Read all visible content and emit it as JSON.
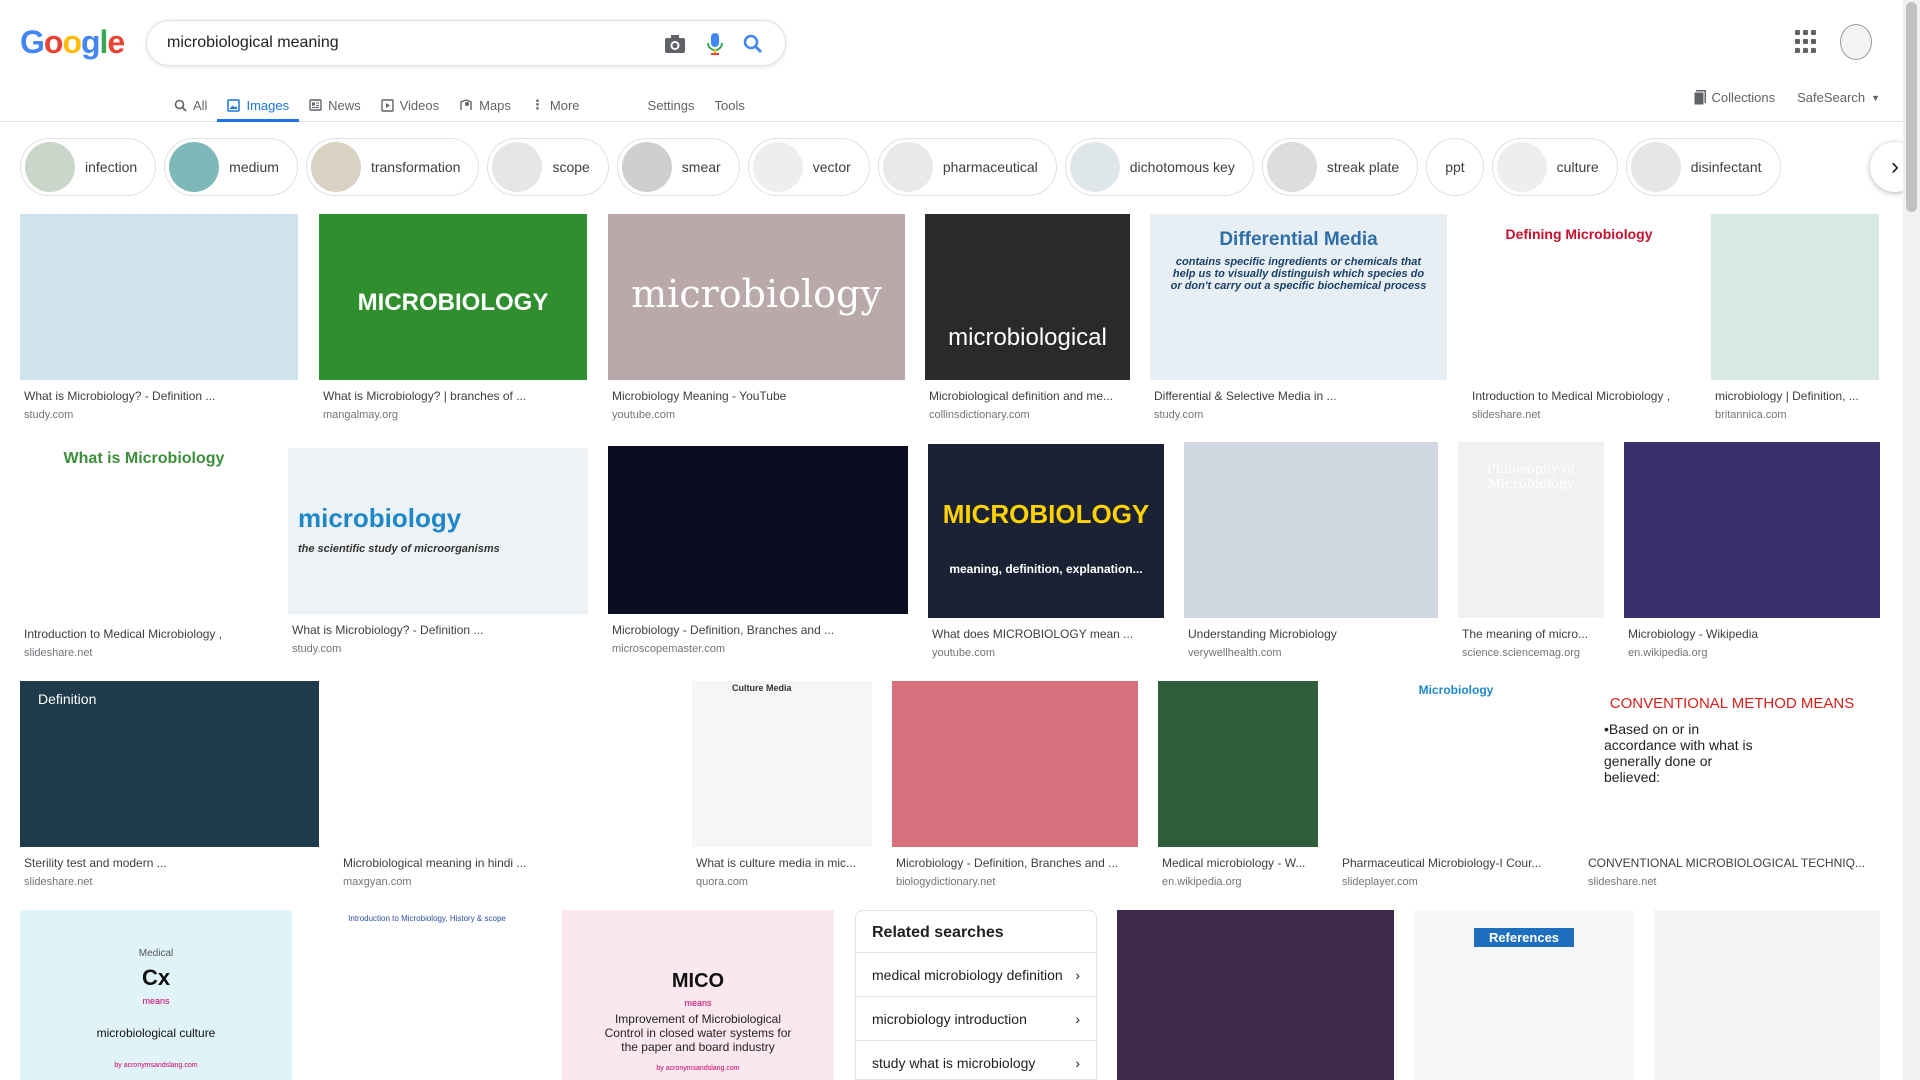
{
  "logo": {
    "g1": "G",
    "o1": "o",
    "o2": "o",
    "g2": "g",
    "l": "l",
    "e": "e"
  },
  "search": {
    "value": "microbiological meaning"
  },
  "tabs": [
    {
      "label": "All"
    },
    {
      "label": "Images"
    },
    {
      "label": "News"
    },
    {
      "label": "Videos"
    },
    {
      "label": "Maps"
    },
    {
      "label": "More"
    }
  ],
  "tools": {
    "settings": "Settings",
    "tools": "Tools",
    "collections": "Collections",
    "safesearch": "SafeSearch"
  },
  "chips": [
    "infection",
    "medium",
    "transformation",
    "scope",
    "smear",
    "vector",
    "pharmaceutical",
    "dichotomous key",
    "streak plate",
    "ppt",
    "culture",
    "disinfectant"
  ],
  "results": [
    {
      "title": "What is Microbiology? - Definition ...",
      "source": "study.com"
    },
    {
      "title": "What is Microbiology? | branches of ...",
      "source": "mangalmay.org",
      "overlay": "MICROBIOLOGY"
    },
    {
      "title": "Microbiology Meaning - YouTube",
      "source": "youtube.com",
      "overlay": "microbiology"
    },
    {
      "title": "Microbiological definition and me...",
      "source": "collinsdictionary.com",
      "overlay": "microbiological"
    },
    {
      "title": "Differential & Selective Media in ...",
      "source": "study.com",
      "overlay": "Differential Media",
      "overlay2": "contains specific ingredients or chemicals that help us to visually distinguish which species do or don't carry out a specific biochemical process"
    },
    {
      "title": "Introduction to Medical Microbiology ,",
      "source": "slideshare.net",
      "overlay": "Defining Microbiology"
    },
    {
      "title": "microbiology | Definition, ...",
      "source": "britannica.com"
    },
    {
      "title": "Introduction to Medical Microbiology ,",
      "source": "slideshare.net",
      "overlay": "What is Microbiology"
    },
    {
      "title": "What is Microbiology? - Definition ...",
      "source": "study.com",
      "overlay": "microbiology",
      "overlay2": "the scientific study of microorganisms"
    },
    {
      "title": "Microbiology - Definition, Branches and ...",
      "source": "microscopemaster.com"
    },
    {
      "title": "What does MICROBIOLOGY mean ...",
      "source": "youtube.com",
      "overlay": "MICROBIOLOGY",
      "overlay2": "meaning, definition, explanation..."
    },
    {
      "title": "Understanding Microbiology",
      "source": "verywellhealth.com"
    },
    {
      "title": "The meaning of micro...",
      "source": "science.sciencemag.org",
      "overlay": "Philosophy of Microbiology"
    },
    {
      "title": "Microbiology - Wikipedia",
      "source": "en.wikipedia.org"
    },
    {
      "title": "Sterility test and modern ...",
      "source": "slideshare.net",
      "overlay": "Definition"
    },
    {
      "title": "Microbiological meaning in hindi ...",
      "source": "maxgyan.com"
    },
    {
      "title": "What is culture media in mic...",
      "source": "quora.com",
      "overlay": "Culture Media"
    },
    {
      "title": "Microbiology - Definition, Branches and ...",
      "source": "biologydictionary.net"
    },
    {
      "title": "Medical microbiology - W...",
      "source": "en.wikipedia.org"
    },
    {
      "title": "Pharmaceutical Microbiology-I Cour...",
      "source": "slideplayer.com",
      "overlay": "Microbiology"
    },
    {
      "title": "CONVENTIONAL MICROBIOLOGICAL TECHNIQ...",
      "source": "slideshare.net",
      "overlay": "CONVENTIONAL METHOD MEANS",
      "overlay2": "•Based on or in accordance with what is generally done or believed:"
    },
    {
      "overlay": "Medical",
      "overlay2": "Cx",
      "overlay3": "means",
      "overlay4": "microbiological culture",
      "overlay5": "by acronymsandslang.com"
    },
    {
      "overlay": "Introduction to Microbiology, History & scope"
    },
    {
      "overlay": "MICO",
      "overlay2": "means",
      "overlay3": "Improvement of Microbiological Control in closed water systems for the paper and board industry",
      "overlay4": "by acronymsandslang.com"
    },
    {},
    {},
    {
      "overlay": "References"
    }
  ],
  "related": {
    "heading": "Related searches",
    "items": [
      "medical microbiology definition",
      "microbiology introduction",
      "study what is microbiology"
    ]
  },
  "colors": {
    "accent": "#1a73e8",
    "border": "#dfe1e5"
  }
}
